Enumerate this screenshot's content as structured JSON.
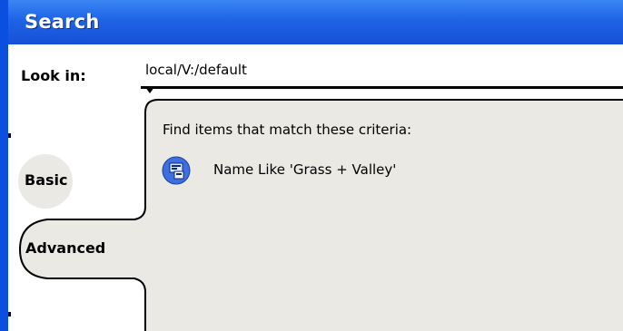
{
  "window": {
    "title": "Search"
  },
  "lookin": {
    "label": "Look in:",
    "value": "local/V:/default"
  },
  "tabs": [
    {
      "label": "Basic",
      "selected": false
    },
    {
      "label": "Advanced",
      "selected": true
    }
  ],
  "criteria": {
    "title": "Find items that match these criteria:",
    "items": [
      {
        "icon": "criteria-rule-icon",
        "text": "Name Like 'Grass + Valley'"
      }
    ]
  },
  "colors": {
    "title_bar": "#1f63e6",
    "panel_bg": "#ebe9e4",
    "icon_bg": "#3d6fe0"
  }
}
